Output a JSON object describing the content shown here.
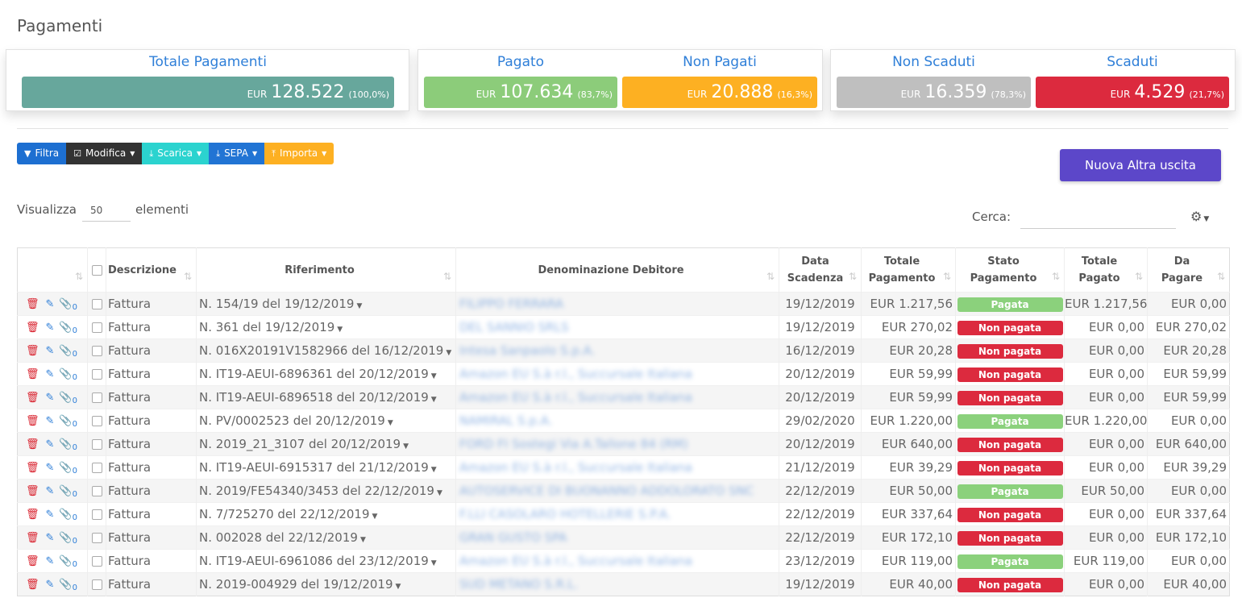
{
  "page": {
    "title": "Pagamenti"
  },
  "colors": {
    "totale": "#67a79c",
    "pagato": "#8ccc7a",
    "non_pagati": "#fdb022",
    "non_scaduti": "#bfbfbf",
    "scaduti": "#dc2a3e",
    "link": "#2f7fd8",
    "primary_button": "#5c47c9"
  },
  "stats": [
    {
      "label": "Totale Pagamenti",
      "currency": "EUR",
      "amount": "128.522",
      "percent": "(100,0%)"
    },
    {
      "label": "Pagato",
      "currency": "EUR",
      "amount": "107.634",
      "percent": "(83,7%)"
    },
    {
      "label": "Non Pagati",
      "currency": "EUR",
      "amount": "20.888",
      "percent": "(16,3%)"
    },
    {
      "label": "Non Scaduti",
      "currency": "EUR",
      "amount": "16.359",
      "percent": "(78,3%)"
    },
    {
      "label": "Scaduti",
      "currency": "EUR",
      "amount": "4.529",
      "percent": "(21,7%)"
    }
  ],
  "toolbar": {
    "filtra": "Filtra",
    "modifica": "Modifica",
    "scarica": "Scarica",
    "sepa": "SEPA",
    "importa": "Importa",
    "icons": {
      "filtra": "filter-icon",
      "modifica": "check-square-icon",
      "scarica": "download-icon",
      "sepa": "download-icon",
      "importa": "upload-icon"
    }
  },
  "nuova_button": "Nuova Altra uscita",
  "length": {
    "prefix": "Visualizza",
    "value": "50",
    "suffix": "elementi"
  },
  "search": {
    "label": "Cerca:",
    "value": ""
  },
  "table": {
    "headers": {
      "descrizione": "Descrizione",
      "riferimento": "Riferimento",
      "denominazione": "Denominazione Debitore",
      "data_l1": "Data",
      "data_l2": "Scadenza",
      "totale_l1": "Totale",
      "totale_l2": "Pagamento",
      "stato_l1": "Stato",
      "stato_l2": "Pagamento",
      "tpagato_l1": "Totale",
      "tpagato_l2": "Pagato",
      "dapagare_l1": "Da",
      "dapagare_l2": "Pagare"
    },
    "rows": [
      {
        "attachments": "0",
        "descrizione": "Fattura",
        "riferimento": "N. 154/19 del 19/12/2019",
        "denominazione": "FILIPPO FERRARA",
        "data": "19/12/2019",
        "totale": "EUR 1.217,56",
        "stato": "Pagata",
        "pagata": true,
        "pagato": "EUR 1.217,56",
        "da_pagare": "EUR 0,00"
      },
      {
        "attachments": "0",
        "descrizione": "Fattura",
        "riferimento": "N. 361 del 19/12/2019",
        "denominazione": "DEL SANNIO SRLS",
        "data": "19/12/2019",
        "totale": "EUR 270,02",
        "stato": "Non pagata",
        "pagata": false,
        "pagato": "EUR 0,00",
        "da_pagare": "EUR 270,02"
      },
      {
        "attachments": "0",
        "descrizione": "Fattura",
        "riferimento": "N. 016X20191V1582966 del 16/12/2019",
        "denominazione": "Intesa Sanpaolo S.p.A.",
        "data": "16/12/2019",
        "totale": "EUR 20,28",
        "stato": "Non pagata",
        "pagata": false,
        "pagato": "EUR 0,00",
        "da_pagare": "EUR 20,28"
      },
      {
        "attachments": "0",
        "descrizione": "Fattura",
        "riferimento": "N. IT19-AEUI-6896361 del 20/12/2019",
        "denominazione": "Amazon EU S.à r.l., Succursale Italiana",
        "data": "20/12/2019",
        "totale": "EUR 59,99",
        "stato": "Non pagata",
        "pagata": false,
        "pagato": "EUR 0,00",
        "da_pagare": "EUR 59,99"
      },
      {
        "attachments": "0",
        "descrizione": "Fattura",
        "riferimento": "N. IT19-AEUI-6896518 del 20/12/2019",
        "denominazione": "Amazon EU S.à r.l., Succursale Italiana",
        "data": "20/12/2019",
        "totale": "EUR 59,99",
        "stato": "Non pagata",
        "pagata": false,
        "pagato": "EUR 0,00",
        "da_pagare": "EUR 59,99"
      },
      {
        "attachments": "0",
        "descrizione": "Fattura",
        "riferimento": "N. PV/0002523 del 20/12/2019",
        "denominazione": "NAMIRAL S.p.A.",
        "data": "29/02/2020",
        "totale": "EUR 1.220,00",
        "stato": "Pagata",
        "pagata": true,
        "pagato": "EUR 1.220,00",
        "da_pagare": "EUR 0,00"
      },
      {
        "attachments": "0",
        "descrizione": "Fattura",
        "riferimento": "N. 2019_21_3107 del 20/12/2019",
        "denominazione": "FORD FI Sostegi Via A.Tallone 84 (RM)",
        "data": "20/12/2019",
        "totale": "EUR 640,00",
        "stato": "Non pagata",
        "pagata": false,
        "pagato": "EUR 0,00",
        "da_pagare": "EUR 640,00"
      },
      {
        "attachments": "0",
        "descrizione": "Fattura",
        "riferimento": "N. IT19-AEUI-6915317 del 21/12/2019",
        "denominazione": "Amazon EU S.à r.l., Succursale Italiana",
        "data": "21/12/2019",
        "totale": "EUR 39,29",
        "stato": "Non pagata",
        "pagata": false,
        "pagato": "EUR 0,00",
        "da_pagare": "EUR 39,29"
      },
      {
        "attachments": "0",
        "descrizione": "Fattura",
        "riferimento": "N. 2019/FE54340/3453 del 22/12/2019",
        "denominazione": "AUTOSERVICE DI BUONANNO ADDOLORATO SNC",
        "data": "22/12/2019",
        "totale": "EUR 50,00",
        "stato": "Pagata",
        "pagata": true,
        "pagato": "EUR 50,00",
        "da_pagare": "EUR 0,00"
      },
      {
        "attachments": "0",
        "descrizione": "Fattura",
        "riferimento": "N. 7/725270 del 22/12/2019",
        "denominazione": "F.LLI CASOLARO HOTELLERIE S.P.A.",
        "data": "22/12/2019",
        "totale": "EUR 337,64",
        "stato": "Non pagata",
        "pagata": false,
        "pagato": "EUR 0,00",
        "da_pagare": "EUR 337,64"
      },
      {
        "attachments": "0",
        "descrizione": "Fattura",
        "riferimento": "N. 002028 del 22/12/2019",
        "denominazione": "GRAN GUSTO SPA",
        "data": "22/12/2019",
        "totale": "EUR 172,10",
        "stato": "Non pagata",
        "pagata": false,
        "pagato": "EUR 0,00",
        "da_pagare": "EUR 172,10"
      },
      {
        "attachments": "0",
        "descrizione": "Fattura",
        "riferimento": "N. IT19-AEUI-6961086 del 23/12/2019",
        "denominazione": "Amazon EU S.à r.l., Succursale Italiana",
        "data": "23/12/2019",
        "totale": "EUR 119,00",
        "stato": "Pagata",
        "pagata": true,
        "pagato": "EUR 119,00",
        "da_pagare": "EUR 0,00"
      },
      {
        "attachments": "0",
        "descrizione": "Fattura",
        "riferimento": "N. 2019-004929 del 19/12/2019",
        "denominazione": "SUD METANO S.R.L.",
        "data": "19/12/2019",
        "totale": "EUR 40,00",
        "stato": "Non pagata",
        "pagata": false,
        "pagato": "EUR 0,00",
        "da_pagare": "EUR 40,00"
      }
    ]
  }
}
